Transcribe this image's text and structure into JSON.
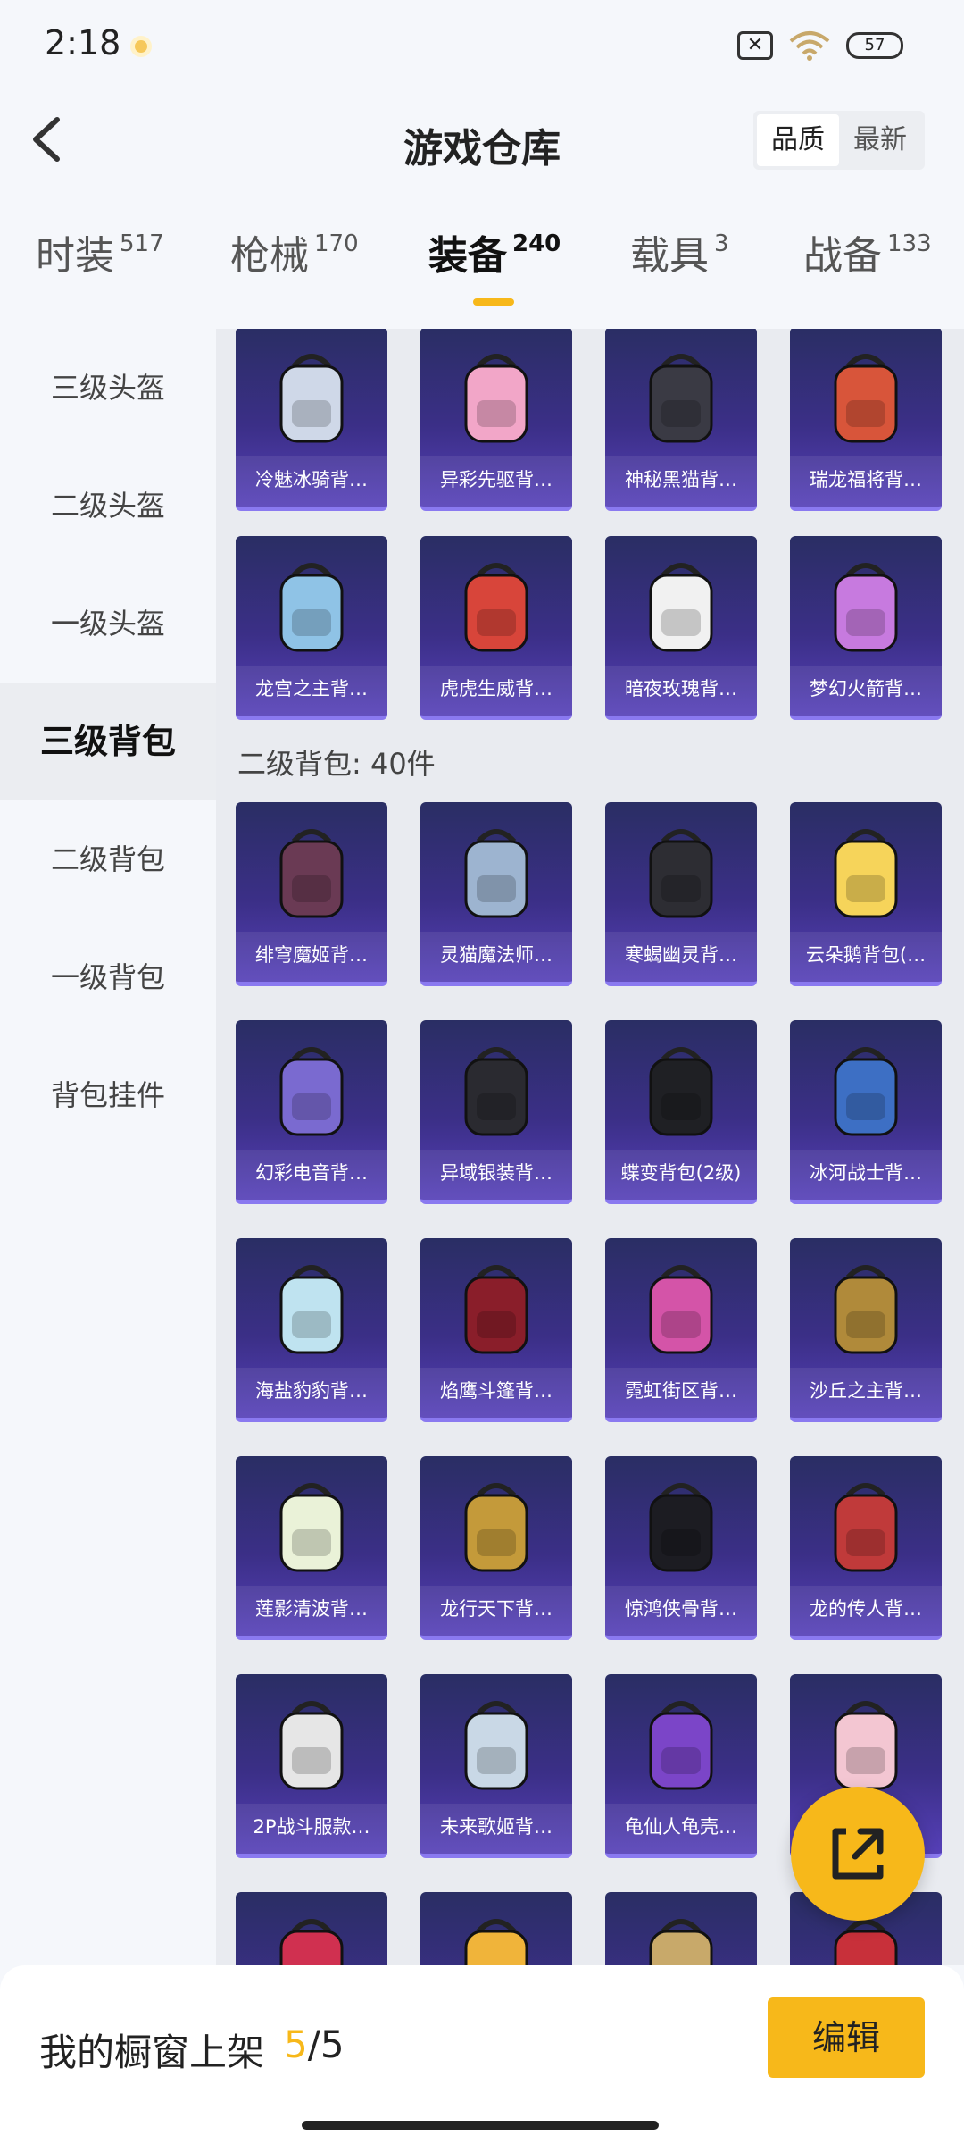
{
  "status_bar": {
    "time": "2:18",
    "battery": "57",
    "icons": [
      "sim-off-icon",
      "wifi-icon",
      "battery-icon"
    ]
  },
  "header": {
    "title": "游戏仓库",
    "back_icon": "chevron-left-icon",
    "sort_options": [
      "品质",
      "最新"
    ],
    "sort_selected": "品质"
  },
  "tabs": [
    {
      "label": "时装",
      "count": "517"
    },
    {
      "label": "枪械",
      "count": "170"
    },
    {
      "label": "装备",
      "count": "240"
    },
    {
      "label": "载具",
      "count": "3"
    },
    {
      "label": "战备",
      "count": "133"
    }
  ],
  "active_tab": "装备",
  "sidebar": {
    "items": [
      "三级头盔",
      "二级头盔",
      "一级头盔",
      "三级背包",
      "二级背包",
      "一级背包",
      "背包挂件"
    ],
    "active": "三级背包"
  },
  "grid": {
    "level3_rows": [
      [
        "冷魅冰骑背…",
        "异彩先驱背…",
        "神秘黑猫背…",
        "瑞龙福将背…"
      ],
      [
        "龙宫之主背…",
        "虎虎生威背…",
        "暗夜玫瑰背…",
        "梦幻火箭背…"
      ]
    ],
    "section_label": "二级背包: 40件",
    "level2_rows": [
      [
        "绯穹魔姬背…",
        "灵猫魔法师…",
        "寒蝎幽灵背…",
        "云朵鹅背包(…"
      ],
      [
        "幻彩电音背…",
        "异域银装背…",
        "蝶变背包(2级)",
        "冰河战士背…"
      ],
      [
        "海盐豹豹背…",
        "焰鹰斗篷背…",
        "霓虹街区背…",
        "沙丘之主背…"
      ],
      [
        "莲影清波背…",
        "龙行天下背…",
        "惊鸿侠骨背…",
        "龙的传人背…"
      ],
      [
        "2P战斗服款…",
        "未来歌姬背…",
        "龟仙人龟壳…",
        ""
      ]
    ],
    "card_colors": {
      "bg_top": "#2a2e64",
      "bg_bottom": "#5640b8",
      "border": "#8a79f0"
    }
  },
  "fab": {
    "icon": "share-external-icon"
  },
  "bottom_bar": {
    "label": "我的橱窗上架",
    "current": "5",
    "separator": "/",
    "total": "5",
    "edit_label": "编辑"
  },
  "colors": {
    "accent": "#f7b81a",
    "background": "#f5f7fb",
    "panel": "#e9ebf0"
  }
}
